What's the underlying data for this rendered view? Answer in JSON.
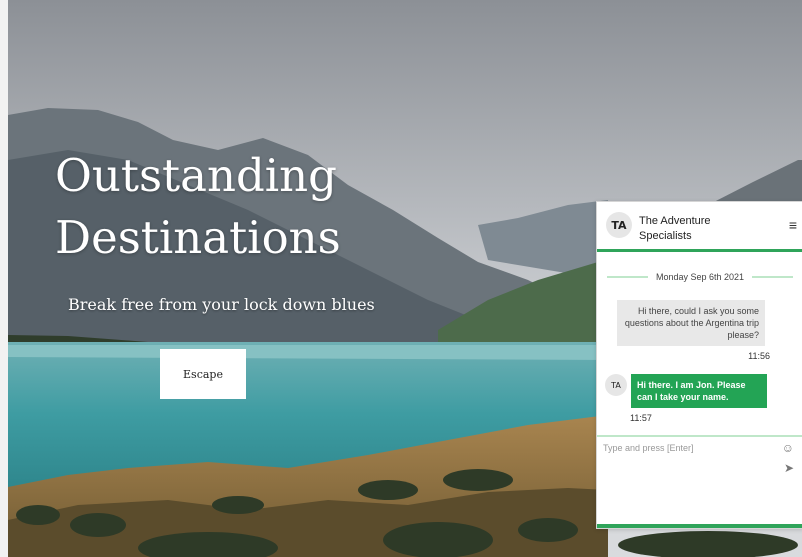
{
  "hero": {
    "title_line1": "Outstanding",
    "title_line2": "Destinations",
    "subtitle": "Break free from your lock down blues",
    "cta_label": "Escape"
  },
  "chat": {
    "avatar_initials": "TA",
    "name_line1": "The Adventure",
    "name_line2": "Specialists",
    "menu_icon": "≡",
    "date": "Monday Sep 6th 2021",
    "incoming": {
      "text": "Hi there, could I ask you some questions about the Argentina trip please?",
      "time": "11:56"
    },
    "outgoing": {
      "avatar": "TA",
      "text": "Hi there. I am Jon. Please can I take your name.",
      "time": "11:57"
    },
    "input_placeholder": "Type and press [Enter]",
    "emoji_icon": "☺",
    "send_icon": "➤"
  }
}
